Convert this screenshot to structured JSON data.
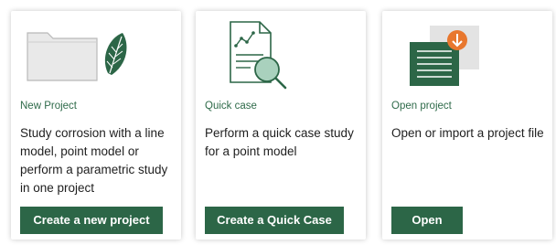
{
  "cards": [
    {
      "label": "New Project",
      "description": "Study corrosion with a line model, point model or perform a parametric study in one project",
      "button": "Create a new project",
      "icon": "folder-leaf-icon"
    },
    {
      "label": "Quick case",
      "description": "Perform a quick case study for a point model",
      "button": "Create a Quick Case",
      "icon": "document-magnifier-icon"
    },
    {
      "label": "Open project",
      "description": "Open or import a project file",
      "button": "Open",
      "icon": "import-file-icon"
    }
  ],
  "colors": {
    "accent": "#2c6647",
    "label": "#2f6b4a",
    "import_badge": "#e8772e"
  }
}
